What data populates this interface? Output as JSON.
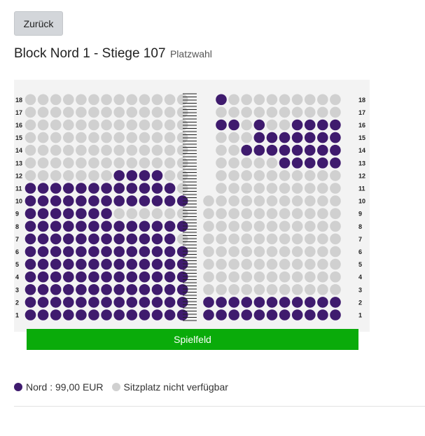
{
  "back_button": {
    "label": "Zurück"
  },
  "header": {
    "title": "Block Nord 1 - Stiege 107",
    "subtitle": "Platzwahl"
  },
  "field": {
    "label": "Spielfeld"
  },
  "legend": {
    "sold": {
      "label": "Nord : 99,00 EUR",
      "color": "#3f1b6e"
    },
    "unavailable": {
      "label": "Sitzplatz nicht verfügbar",
      "color": "#d0d0d0"
    }
  },
  "rows": [
    "1",
    "2",
    "3",
    "4",
    "5",
    "6",
    "7",
    "8",
    "9",
    "10",
    "11",
    "12",
    "13",
    "14",
    "15",
    "16",
    "17",
    "18"
  ],
  "seatmap": {
    "left_block": {
      "rows": {
        "1": "1111111111111",
        "2": "1111111111111",
        "3": "1111111111111",
        "4": "1111111111111",
        "5": "1111111111111",
        "6": "1111111111111",
        "7": "1111111111110",
        "8": "1111111111111",
        "9": "1111111000000",
        "10": "1111111111111",
        "11": "1111111111110",
        "12": "0000000111100",
        "13": "0000000000000",
        "14": "0000000000000",
        "15": "0000000000000",
        "16": "0000000000000",
        "17": "0000000000000",
        "18": "0000000000000"
      }
    },
    "right_block": {
      "rows": {
        "1": "11111111111",
        "2": "11111111111",
        "3": "00000000000",
        "4": "00000000000",
        "5": "00000000000",
        "6": "00000000000",
        "7": "00000000000",
        "8": "00000000000",
        "9": "00000000000",
        "10": "00000000000",
        "11": "0000000000",
        "12": "0000000000",
        "13": "0000011111",
        "14": "0011111111",
        "15": "0001111111",
        "16": "1101001111",
        "17": "0000000000",
        "18": "1000000000"
      }
    }
  }
}
